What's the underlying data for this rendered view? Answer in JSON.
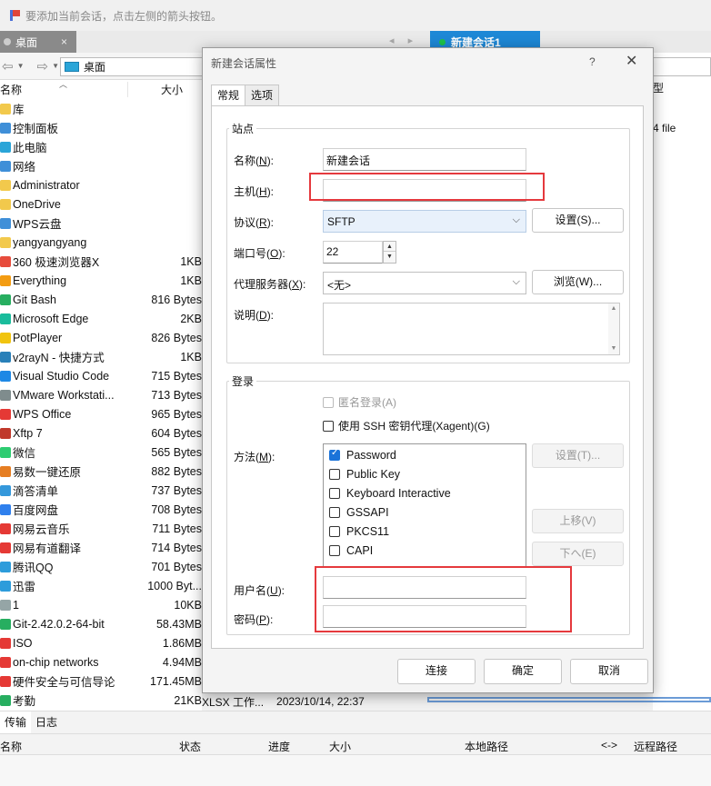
{
  "notice": {
    "text": "要添加当前会话，点击左侧的箭头按钮。"
  },
  "tabs": {
    "desktop": "桌面",
    "session": "新建会话1",
    "close": "×",
    "nav": "◂ ▸"
  },
  "left_pane": {
    "path": "桌面",
    "col_name": "名称",
    "col_size": "大小",
    "files": [
      {
        "name": "库",
        "size": "",
        "color": "#f2c94c"
      },
      {
        "name": "控制面板",
        "size": "",
        "color": "#3f8fd8"
      },
      {
        "name": "此电脑",
        "size": "",
        "color": "#2aa5d8"
      },
      {
        "name": "网络",
        "size": "",
        "color": "#3f8fd8"
      },
      {
        "name": "Administrator",
        "size": "",
        "color": "#f2c94c"
      },
      {
        "name": "OneDrive",
        "size": "",
        "color": "#f2c94c"
      },
      {
        "name": "WPS云盘",
        "size": "",
        "color": "#3f8fd8"
      },
      {
        "name": "yangyangyang",
        "size": "",
        "color": "#f2c94c"
      },
      {
        "name": "360 极速浏览器X",
        "size": "1KB",
        "color": "#e74c3c"
      },
      {
        "name": "Everything",
        "size": "1KB",
        "color": "#f39c12"
      },
      {
        "name": "Git Bash",
        "size": "816 Bytes",
        "color": "#27ae60"
      },
      {
        "name": "Microsoft Edge",
        "size": "2KB",
        "color": "#1abc9c"
      },
      {
        "name": "PotPlayer",
        "size": "826 Bytes",
        "color": "#f1c40f"
      },
      {
        "name": "v2rayN - 快捷方式",
        "size": "1KB",
        "color": "#2980b9"
      },
      {
        "name": "Visual Studio Code",
        "size": "715 Bytes",
        "color": "#1e88e5"
      },
      {
        "name": "VMware Workstati...",
        "size": "713 Bytes",
        "color": "#7f8c8d"
      },
      {
        "name": "WPS Office",
        "size": "965 Bytes",
        "color": "#e53935"
      },
      {
        "name": "Xftp 7",
        "size": "604 Bytes",
        "color": "#c0392b"
      },
      {
        "name": "微信",
        "size": "565 Bytes",
        "color": "#2ecc71"
      },
      {
        "name": "易数一键还原",
        "size": "882 Bytes",
        "color": "#e67e22"
      },
      {
        "name": "滴答清单",
        "size": "737 Bytes",
        "color": "#3498db"
      },
      {
        "name": "百度网盘",
        "size": "708 Bytes",
        "color": "#2f80ed"
      },
      {
        "name": "网易云音乐",
        "size": "711 Bytes",
        "color": "#e53935"
      },
      {
        "name": "网易有道翻译",
        "size": "714 Bytes",
        "color": "#e53935"
      },
      {
        "name": "腾讯QQ",
        "size": "701 Bytes",
        "color": "#2d9cdb"
      },
      {
        "name": "迅雷",
        "size": "1000 Byt...",
        "color": "#2d9cdb"
      },
      {
        "name": "1",
        "size": "10KB",
        "color": "#95a5a6"
      },
      {
        "name": "Git-2.42.0.2-64-bit",
        "size": "58.43MB",
        "color": "#27ae60"
      },
      {
        "name": "ISO",
        "size": "1.86MB",
        "color": "#e53935"
      },
      {
        "name": "on-chip networks",
        "size": "4.94MB",
        "color": "#e53935"
      },
      {
        "name": "硬件安全与可信导论",
        "size": "171.45MB",
        "color": "#e53935"
      },
      {
        "name": "考勤",
        "size": "21KB",
        "color": "#27ae60"
      }
    ]
  },
  "peek": {
    "type": "XLSX 工作...",
    "date": "2023/10/14, 22:37"
  },
  "right_pane": {
    "col": "型",
    "item": "4 file"
  },
  "transfer": {
    "tab_transfer": "传输",
    "tab_log": "日志",
    "cols": [
      "名称",
      "状态",
      "进度",
      "大小",
      "本地路径",
      "<->",
      "远程路径"
    ]
  },
  "dialog": {
    "title": "新建会话属性",
    "help": "?",
    "close": "✕",
    "tab_general": "常规",
    "tab_options": "选项",
    "site_group": "站点",
    "name_label": "名称",
    "name_key": "(N):",
    "name_hot": "N",
    "name_value": "新建会话",
    "host_label": "主机",
    "host_hot": "H",
    "host_value": "",
    "protocol_label": "协议",
    "protocol_hot": "R",
    "protocol_value": "SFTP",
    "settings_btn": "设置(S)...",
    "port_label": "端口号",
    "port_hot": "O",
    "port_value": "22",
    "proxy_label": "代理服务器",
    "proxy_hot": "X",
    "proxy_value": "<无>",
    "browse_btn": "浏览(W)...",
    "desc_label": "说明",
    "desc_hot": "D",
    "login_group": "登录",
    "anon_login": "匿名登录(A)",
    "ssh_agent": "使用 SSH 密钥代理(Xagent)(G)",
    "method_label": "方法",
    "method_hot": "M",
    "methods": [
      {
        "label": "Password",
        "checked": true
      },
      {
        "label": "Public Key",
        "checked": false
      },
      {
        "label": "Keyboard Interactive",
        "checked": false
      },
      {
        "label": "GSSAPI",
        "checked": false
      },
      {
        "label": "PKCS11",
        "checked": false
      },
      {
        "label": "CAPI",
        "checked": false
      }
    ],
    "method_settings_btn": "设置(T)...",
    "move_up_btn": "上移(V)",
    "move_down_btn": "下へ(E)",
    "user_label": "用户名",
    "user_hot": "U",
    "user_value": "",
    "pass_label": "密码",
    "pass_hot": "P",
    "pass_value": "",
    "connect_btn": "连接",
    "ok_btn": "确定",
    "cancel_btn": "取消"
  },
  "colors": {
    "accent": "#1e88d6",
    "highlight": "#e5393d",
    "checked": "#1a73d9"
  }
}
